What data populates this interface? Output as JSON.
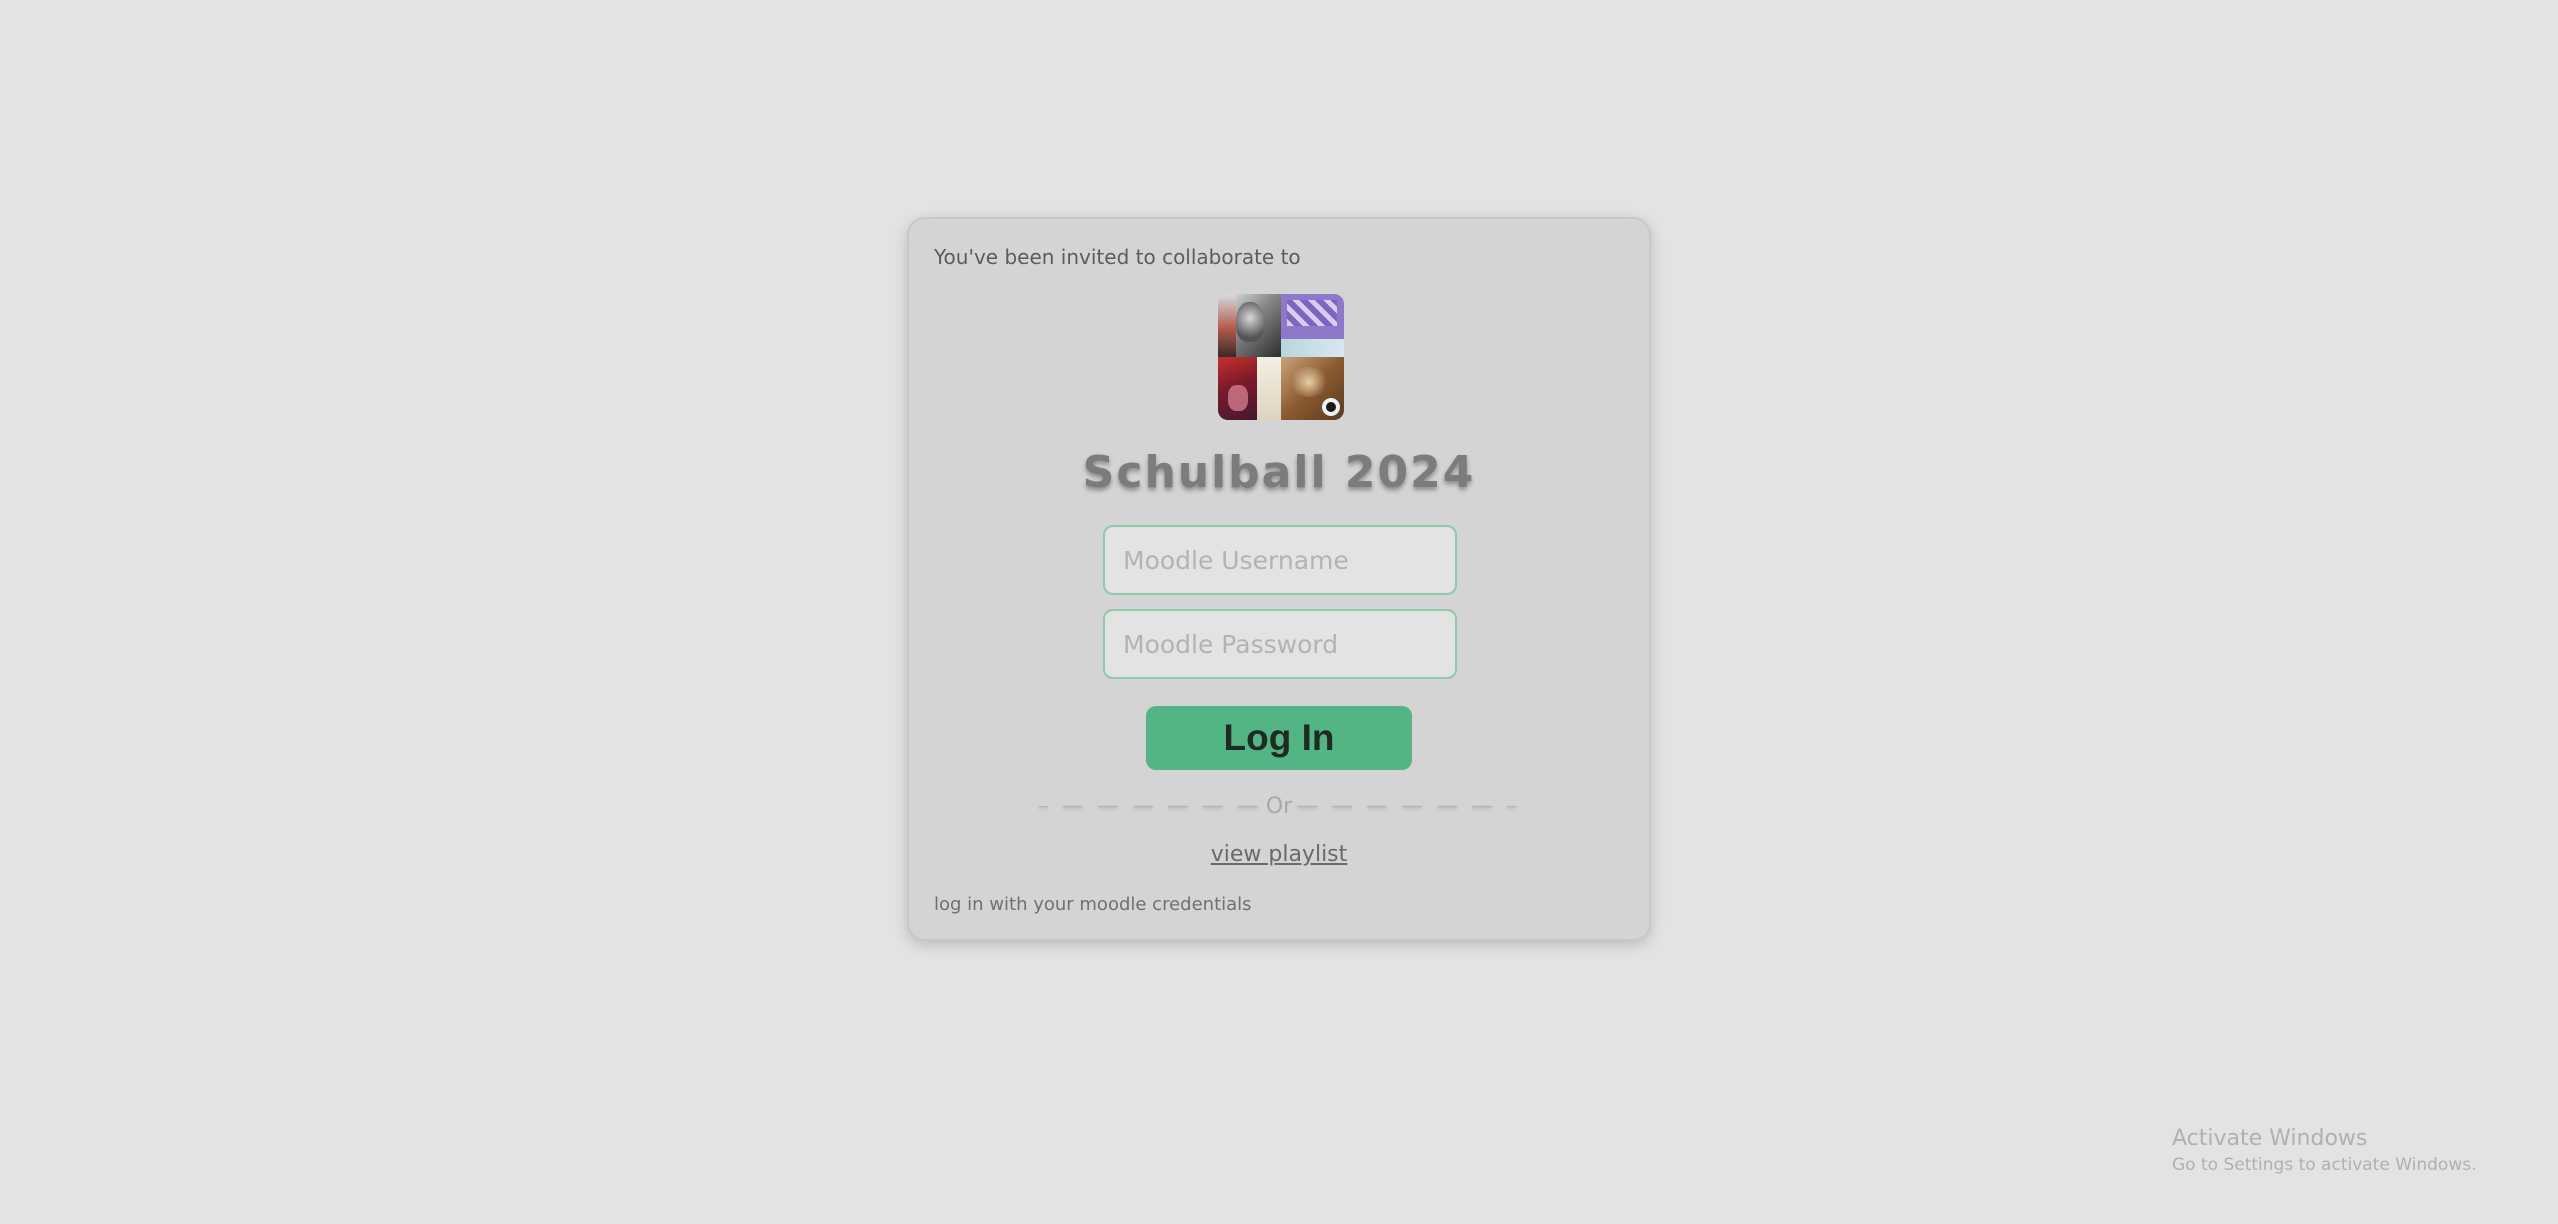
{
  "invite": {
    "text": "You've been invited to collaborate to"
  },
  "playlist": {
    "cover_icon": "playlist-cover-mosaic",
    "title": "Schulball 2024"
  },
  "form": {
    "username_placeholder": "Moodle Username",
    "password_placeholder": "Moodle Password",
    "login_label": "Log In",
    "accent_color": "#52b583"
  },
  "divider": {
    "left": "– — — — — — —",
    "text": "Or",
    "right": "— — — — — — –"
  },
  "links": {
    "view_playlist": "view playlist"
  },
  "footer": {
    "note": "log in with your moodle credentials"
  },
  "watermark": {
    "title": "Activate Windows",
    "subtitle": "Go to Settings to activate Windows."
  }
}
